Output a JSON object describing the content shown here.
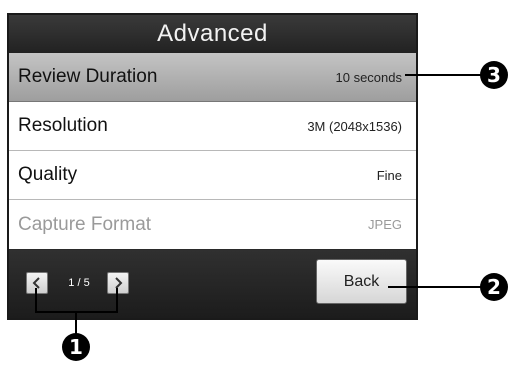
{
  "screen": {
    "title": "Advanced",
    "settings": [
      {
        "label": "Review Duration",
        "value": "10 seconds"
      },
      {
        "label": "Resolution",
        "value": "3M (2048x1536)"
      },
      {
        "label": "Quality",
        "value": "Fine"
      },
      {
        "label": "Capture Format",
        "value": "JPEG"
      }
    ],
    "pager": {
      "text": "1 / 5",
      "prev_icon": "chevron-left-icon",
      "next_icon": "chevron-right-icon"
    },
    "back_label": "Back"
  },
  "callouts": {
    "pager": "1",
    "back": "2",
    "selected_row": "3"
  }
}
